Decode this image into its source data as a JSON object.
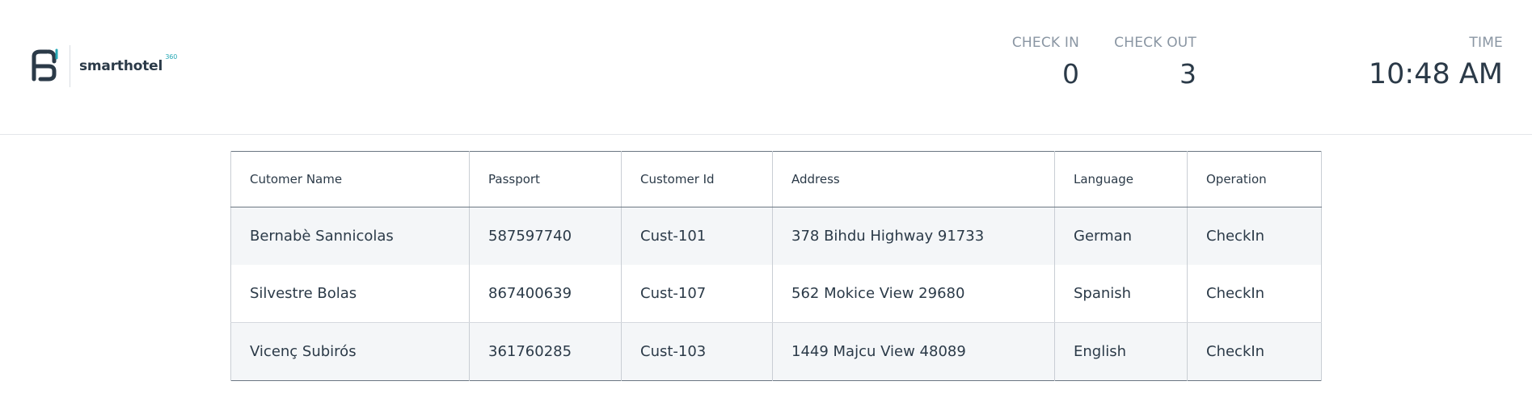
{
  "brand": {
    "name": "smarthotel",
    "superscript": "360",
    "colors": {
      "mark_dark": "#2b3a48",
      "mark_accent": "#27a9b6"
    }
  },
  "stats": {
    "check_in": {
      "label": "CHECK IN",
      "value": "0"
    },
    "check_out": {
      "label": "CHECK OUT",
      "value": "3"
    },
    "time": {
      "label": "TIME",
      "value": "10:48 AM"
    }
  },
  "table": {
    "columns": [
      "Cutomer Name",
      "Passport",
      "Customer Id",
      "Address",
      "Language",
      "Operation"
    ],
    "rows": [
      [
        "Bernabè Sannicolas",
        "587597740",
        "Cust-101",
        "378 Bihdu Highway 91733",
        "German",
        "CheckIn"
      ],
      [
        "Silvestre Bolas",
        "867400639",
        "Cust-107",
        "562 Mokice View 29680",
        "Spanish",
        "CheckIn"
      ],
      [
        "Vicenç Subirós",
        "361760285",
        "Cust-103",
        "1449 Majcu View 48089",
        "English",
        "CheckIn"
      ]
    ]
  }
}
